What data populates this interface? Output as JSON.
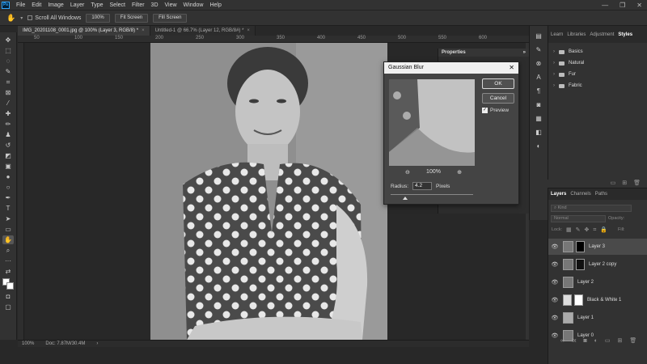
{
  "menu": {
    "logo": "Ps",
    "items": [
      "File",
      "Edit",
      "Image",
      "Layer",
      "Type",
      "Select",
      "Filter",
      "3D",
      "View",
      "Window",
      "Help"
    ]
  },
  "options": {
    "scroll_all": "Scroll All Windows",
    "zoom": "100%",
    "fit_screen": "Fit Screen",
    "fill_screen": "Fill Screen"
  },
  "tabs": [
    {
      "label": "IMG_20201108_0001.jpg @ 100% (Layer 3, RGB/8) *"
    },
    {
      "label": "Untitled-1 @ 66.7% (Layer 12, RGB/8#) *"
    }
  ],
  "ruler": [
    "50",
    "100",
    "150",
    "200",
    "250",
    "300",
    "350",
    "400",
    "450",
    "500",
    "550",
    "600"
  ],
  "status": {
    "zoom": "100%",
    "doc": "Doc: 7.87M/30.4M"
  },
  "properties": {
    "title": "Properties"
  },
  "dialog": {
    "title": "Gaussian Blur",
    "ok": "OK",
    "cancel": "Cancel",
    "preview": "Preview",
    "zoom_level": "100%",
    "radius_label": "Radius:",
    "radius_value": "4.2",
    "radius_unit": "Pixels",
    "radius_slider_fraction": 0.18
  },
  "libraries": {
    "tabs": [
      "Learn",
      "Libraries",
      "Adjustment",
      "Styles"
    ],
    "active_tab": "Styles",
    "folders": [
      "Basics",
      "Natural",
      "Fur",
      "Fabric"
    ]
  },
  "layers": {
    "tabs": [
      "Layers",
      "Channels",
      "Paths"
    ],
    "kind": "Kind",
    "blend": "Normal",
    "opacity_label": "Opacity:",
    "lock_label": "Lock:",
    "fill_label": "Fill:",
    "items": [
      {
        "name": "Layer 3",
        "selected": true
      },
      {
        "name": "Layer 2 copy",
        "selected": false
      },
      {
        "name": "Layer 2",
        "selected": false
      },
      {
        "name": "Black & White 1",
        "selected": false
      },
      {
        "name": "Layer 1",
        "selected": false
      },
      {
        "name": "Layer 0",
        "selected": false
      }
    ]
  },
  "colors": {
    "accent": "#31a8ff",
    "panel": "#323232",
    "canvas": "#282828"
  }
}
